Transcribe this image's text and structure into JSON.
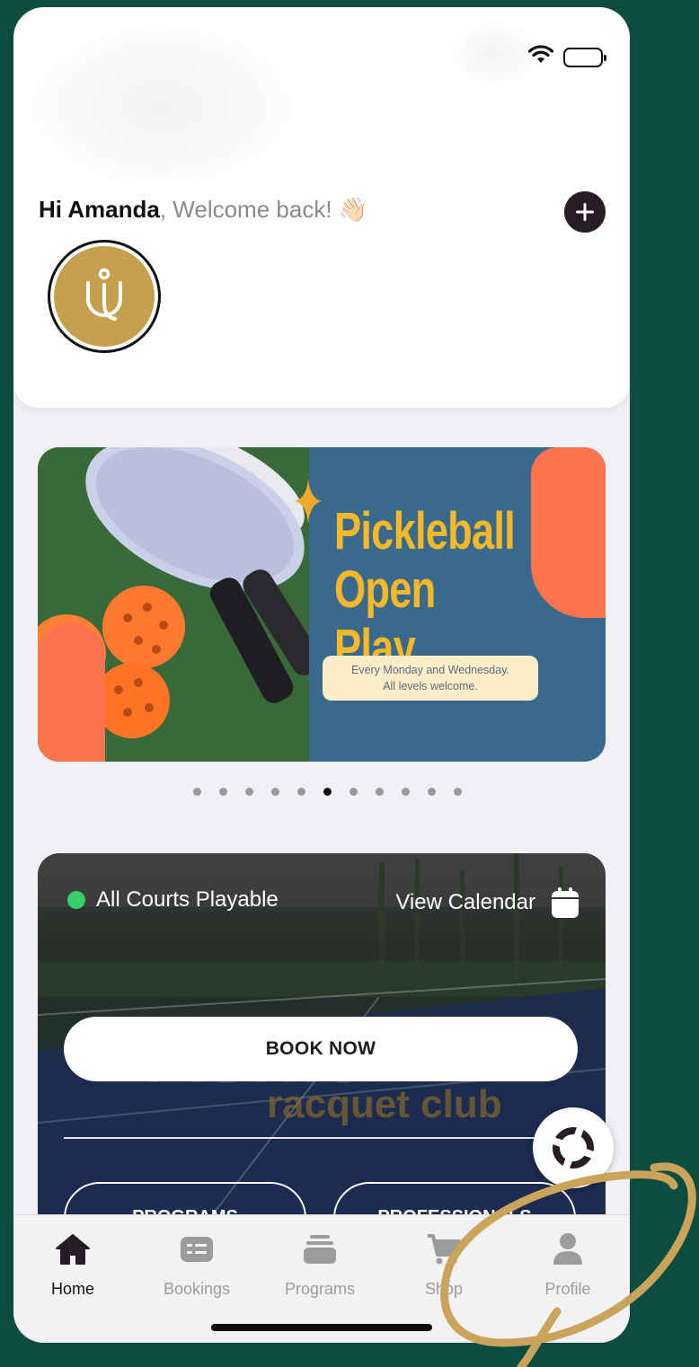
{
  "greeting": {
    "name": "Hi Amanda",
    "welcome": ", Welcome back! 👋🏻"
  },
  "banner": {
    "title_line1": "Pickleball",
    "title_line2": "Open Play",
    "subtitle_line1": "Every Monday and Wednesday.",
    "subtitle_line2": "All levels welcome."
  },
  "carousel": {
    "count": 11,
    "active_index": 5
  },
  "courts": {
    "status": "All Courts Playable",
    "view_calendar": "View Calendar",
    "book_now": "BOOK NOW",
    "background_text": "racquet club",
    "programs_label": "PROGRAMS",
    "professionals_label": "PROFESSIONALS"
  },
  "tabs": [
    {
      "label": "Home",
      "icon": "home-icon"
    },
    {
      "label": "Bookings",
      "icon": "bookings-icon"
    },
    {
      "label": "Programs",
      "icon": "programs-icon"
    },
    {
      "label": "Shop",
      "icon": "cart-icon"
    },
    {
      "label": "Profile",
      "icon": "profile-icon"
    }
  ],
  "colors": {
    "background": "#0c4d40",
    "brand_gold": "#c6a04f",
    "banner_yellow": "#f5b82a",
    "banner_coral": "#fc7350",
    "banner_blue": "#3a6a8b",
    "status_green": "#36d06a",
    "annotation": "#c9a45a"
  }
}
